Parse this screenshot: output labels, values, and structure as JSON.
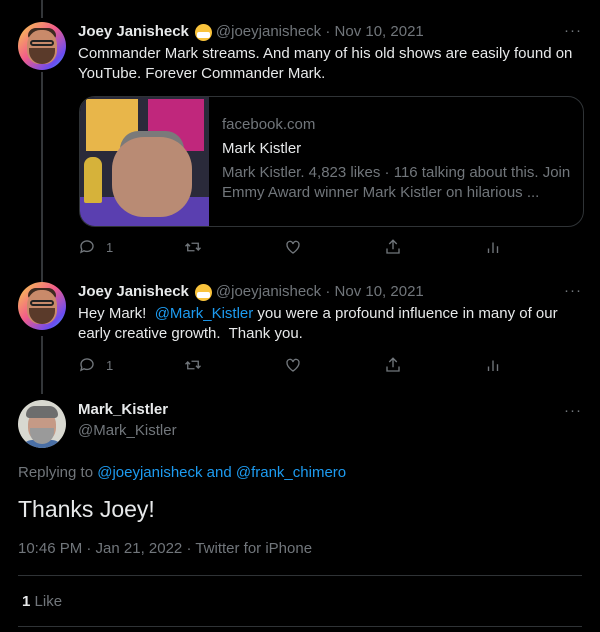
{
  "tweets": [
    {
      "name": "Joey Janisheck",
      "handle": "@joeyjanisheck",
      "date": "Nov 10, 2021",
      "text": "Commander Mark streams.  And many of his old shows are easily found on YouTube.  Forever Commander Mark.",
      "card": {
        "domain": "facebook.com",
        "title": "Mark Kistler",
        "description": "Mark Kistler. 4,823 likes · 116 talking about this. Join Emmy Award winner Mark Kistler on hilarious ..."
      },
      "reply_count": "1"
    },
    {
      "name": "Joey Janisheck",
      "handle": "@joeyjanisheck",
      "date": "Nov 10, 2021",
      "text_before": "Hey Mark!  ",
      "mention": "@Mark_Kistler",
      "text_after": " you were a profound influence in many of our early creative growth.  Thank you.",
      "reply_count": "1"
    }
  ],
  "main_tweet": {
    "name": "Mark_Kistler",
    "handle": "@Mark_Kistler",
    "replying_prefix": "Replying to ",
    "replying_to": "@joeyjanisheck and @frank_chimero",
    "text": "Thanks Joey!",
    "meta": "10:46 PM · Jan 21, 2022 · Twitter for iPhone",
    "like_count": "1",
    "like_label": "Like"
  },
  "more_label": "···",
  "date_separator": " · ",
  "colors": {
    "accent": "#1d9bf0",
    "muted": "#71767b",
    "background": "#000000"
  }
}
